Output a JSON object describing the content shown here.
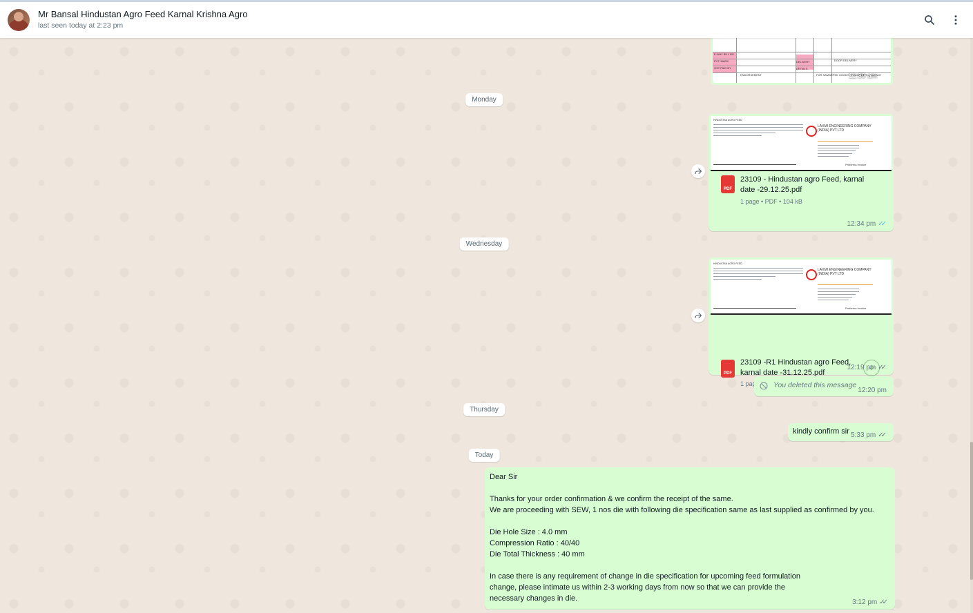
{
  "header": {
    "chat_name": "Mr Bansal Hindustan Agro Feed Karnal Krishna Agro",
    "status": "last seen today at 2:23 pm",
    "avatar_icon": "contact-avatar",
    "search_icon": "search-icon",
    "menu_icon": "more-vertical-icon"
  },
  "invoice_preview": {
    "time": "11:39 am",
    "labels": {
      "way_bill": "E-WAY BILL NO.",
      "pvt_mark": "PVT. MARK",
      "gst_paid_by": "GST PAID BY",
      "delivery": "DELIVERY",
      "details": "DETAILS",
      "endorsement": "ENDORSEMENT",
      "door_delivery": "DOOR DELIVERY",
      "transporter": "FOR SAMARPEE GOODS TRANSPORT COMPANY"
    }
  },
  "day_separators": {
    "monday": "Monday",
    "wednesday": "Wednesday",
    "thursday": "Thursday",
    "today": "Today"
  },
  "messages": [
    {
      "type": "document",
      "file_name": "23109 - Hindustan agro Feed, karnal date -29.12.25.pdf",
      "file_meta": "1 page • PDF • 104 kB",
      "time": "12:34 pm",
      "status": "read"
    },
    {
      "type": "document",
      "file_name": "23109 -R1 Hindustan agro Feed, karnal date -31.12.25.pdf",
      "file_meta": "1 page • PDF • 104 kB",
      "time": "12:19 pm",
      "status": "delivered"
    },
    {
      "type": "deleted",
      "text": "You deleted this message",
      "time": "12:20 pm"
    },
    {
      "type": "text",
      "text": "kindly confirm sir",
      "time": "5:33 pm",
      "status": "delivered"
    },
    {
      "type": "text",
      "text": "Dear Sir\n\nThanks for your order confirmation & we confirm the receipt of the same.\nWe are proceeding with SEW, 1 nos die with following die specification same as last supplied as confirmed by you.\n\nDie Hole Size : 4.0 mm\nCompression Ratio : 40/40\nDie Total Thickness : 40 mm\n\nIn case there is any requirement of change in die specification for upcoming feed formulation\nchange, please intimate us within 2-3 working days from now so that we can provide the\nnecessary changes in die.",
      "time": "3:12 pm",
      "status": "delivered"
    }
  ],
  "doc_thumb": {
    "company": "LAXMI ENGINEERING COMPANY (INDIA) PVT LTD",
    "heading": "Proforma Invoice",
    "customer": "HINDUSTAN AGRO FEED"
  },
  "pdf_badge": "PDF",
  "colors": {
    "outgoing_bubble": "#d9fdd3",
    "chat_background": "#efe7de",
    "read_ticks": "#53bdeb",
    "pdf_red": "#e53935"
  }
}
